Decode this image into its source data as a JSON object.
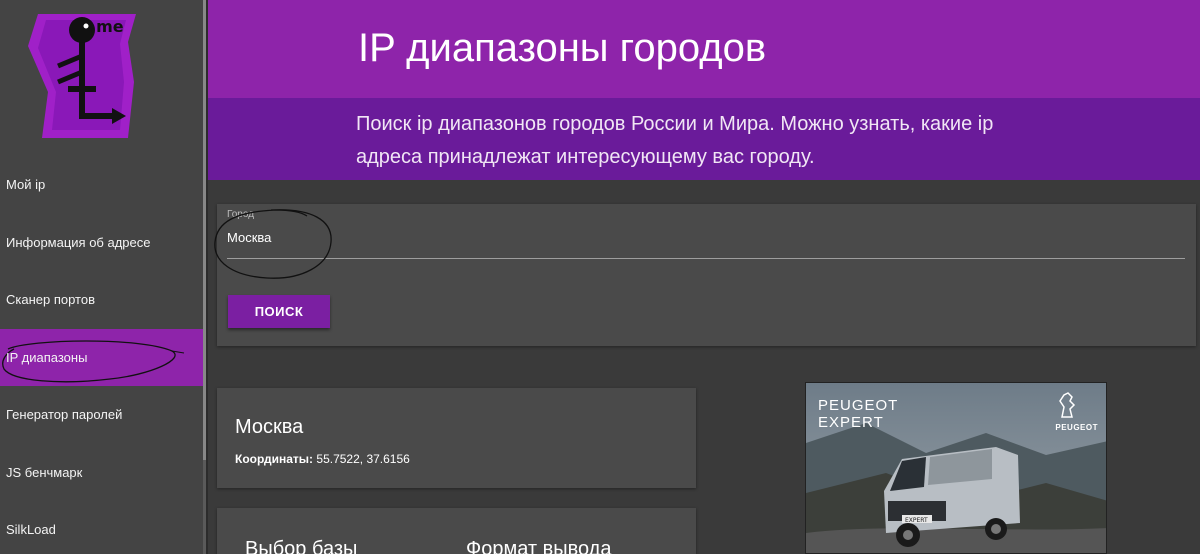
{
  "sidebar": {
    "logo_text": ".me",
    "items": [
      {
        "label": "Мой ip",
        "active": false
      },
      {
        "label": "Информация об адресе",
        "active": false
      },
      {
        "label": "Сканер портов",
        "active": false
      },
      {
        "label": "IP диапазоны",
        "active": true
      },
      {
        "label": "Генератор паролей",
        "active": false
      },
      {
        "label": "JS бенчмарк",
        "active": false
      },
      {
        "label": "SilkLoad",
        "active": false
      }
    ]
  },
  "header": {
    "title": "IP диапазоны городов",
    "subtitle": "Поиск ip диапазонов городов России и Мира. Можно узнать, какие ip адреса принадлежат интересующему вас городу."
  },
  "search": {
    "field_label": "Город",
    "field_value": "Москва",
    "button_label": "ПОИСК"
  },
  "result": {
    "city": "Москва",
    "coords_label": "Координаты:",
    "coords_value": " 55.7522, 37.6156"
  },
  "options": {
    "db_heading": "Выбор базы",
    "format_heading": "Формат вывода"
  },
  "ad": {
    "brand_line1": "PEUGEOT",
    "brand_line2": "EXPERT",
    "logo_text": "PEUGEOT",
    "plate_text": "EXPERT"
  },
  "colors": {
    "accent": "#8e24aa",
    "accent_dark": "#6a1b9a",
    "button": "#7b1fa2",
    "sidebar_bg": "#444444",
    "card_bg": "#4a4a4a",
    "page_bg": "#3a3a3a"
  },
  "icons": [
    "site-logo",
    "peugeot-lion-icon"
  ]
}
